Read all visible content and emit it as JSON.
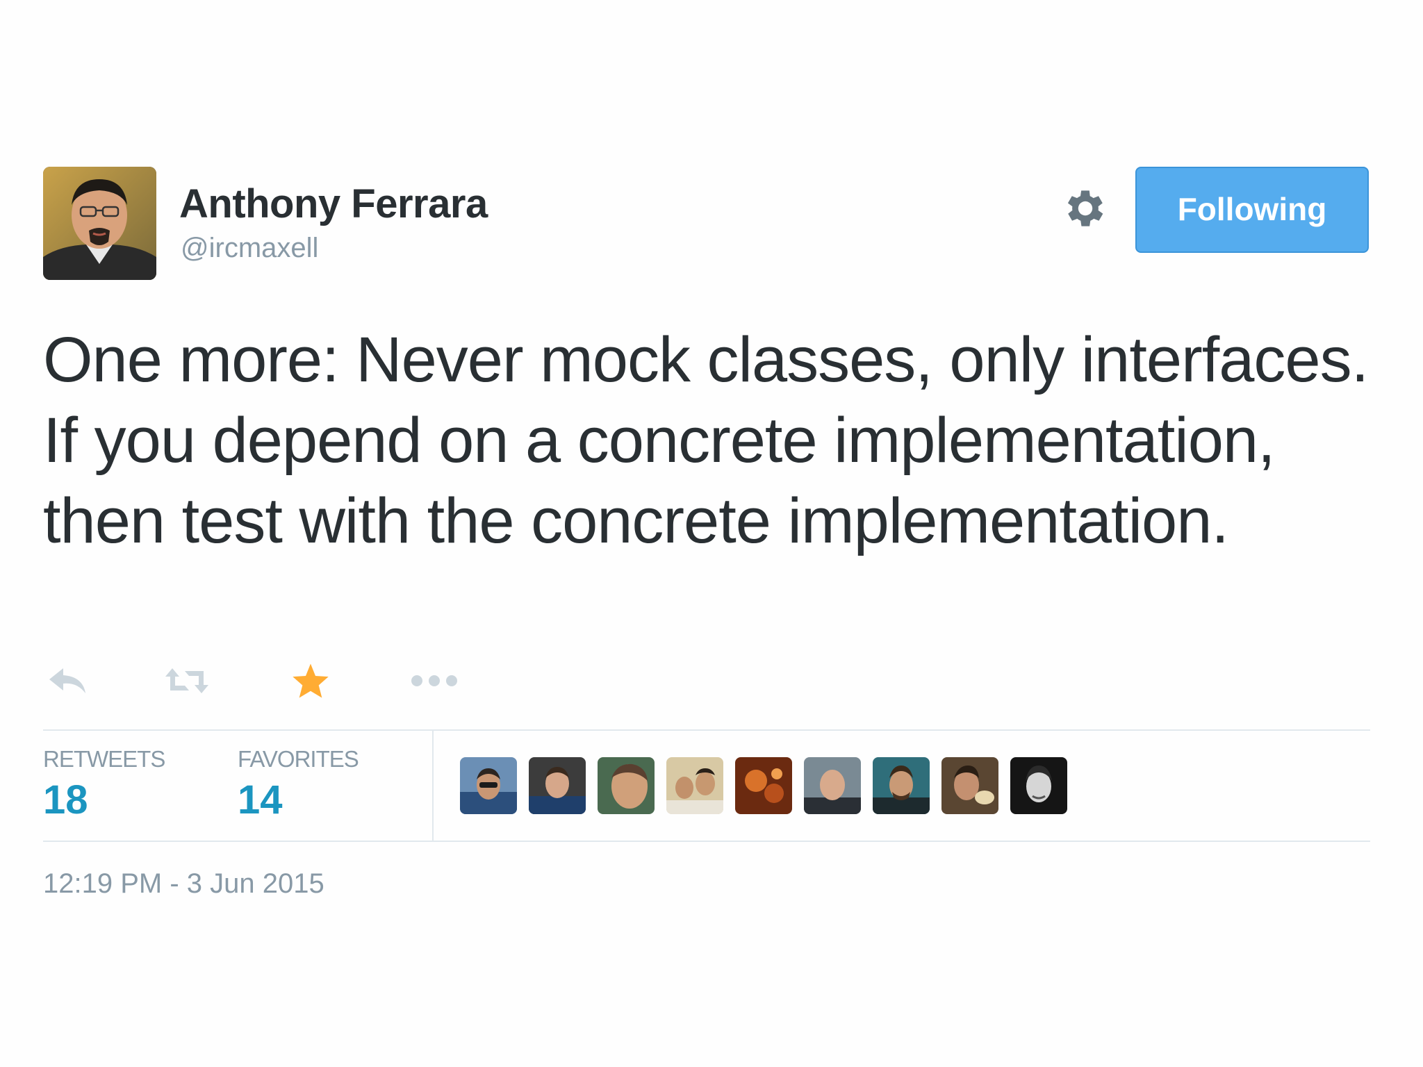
{
  "author": {
    "name": "Anthony Ferrara",
    "handle": "@ircmaxell",
    "avatar_icon": "profile-photo"
  },
  "header": {
    "settings_icon": "gear-icon",
    "follow_button_label": "Following"
  },
  "tweet": {
    "text": "One more: Never mock classes, only interfaces. If you depend on a concrete implementation, then test with the concrete implementation."
  },
  "actions": {
    "reply_icon": "reply-icon",
    "retweet_icon": "retweet-icon",
    "favorite_icon": "star-icon",
    "more_icon": "more-icon",
    "favorite_color": "#ffac33",
    "inactive_color": "#ccd6dd"
  },
  "stats": {
    "retweets_label": "RETWEETS",
    "retweets_count": "18",
    "favorites_label": "FAVORITES",
    "favorites_count": "14"
  },
  "favorited_by_count": 9,
  "timestamp": "12:19 PM - 3 Jun 2015",
  "colors": {
    "accent": "#55acee",
    "stat_value": "#1b95c0",
    "muted": "#8899a6",
    "text": "#292f33"
  }
}
